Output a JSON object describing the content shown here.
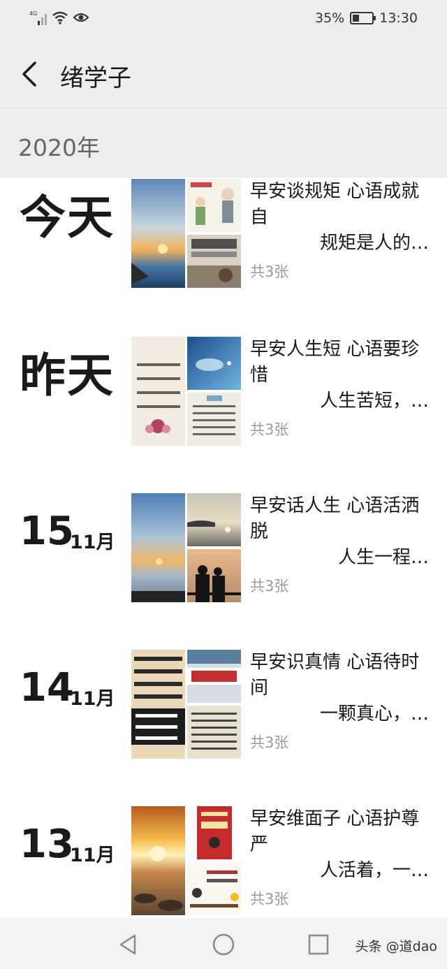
{
  "status_bar": {
    "network": "4G",
    "battery": "35%",
    "battery_level": 0.35,
    "time": "13:30"
  },
  "header": {
    "back_icon": "chevron-left-icon",
    "title": "绪学子"
  },
  "year": "2020年",
  "entries": [
    {
      "date": "今天",
      "title": "早安谈规矩 心语成就自",
      "subtitle": "规矩是人的…",
      "count": "共3张"
    },
    {
      "date": "昨天",
      "title": "早安人生短 心语要珍惜",
      "subtitle": "人生苦短，…",
      "count": "共3张"
    },
    {
      "day": "15",
      "month": "11月",
      "title": "早安话人生 心语活洒脱",
      "subtitle": "人生一程…",
      "count": "共3张"
    },
    {
      "day": "14",
      "month": "11月",
      "title": "早安识真情 心语待时间",
      "subtitle": "一颗真心，…",
      "count": "共3张"
    },
    {
      "day": "13",
      "month": "11月",
      "title": "早安维面子 心语护尊严",
      "subtitle": "人活着，一…",
      "count": "共3张"
    }
  ],
  "nav": {
    "back_icon": "triangle-back-icon",
    "home_icon": "circle-home-icon",
    "recents_icon": "square-recents-icon"
  },
  "watermark": "头条 @道dao",
  "colors": {
    "header_bg": "#ededed",
    "muted_text": "#9a9a9a",
    "nav_bg": "#f2f2f2"
  }
}
